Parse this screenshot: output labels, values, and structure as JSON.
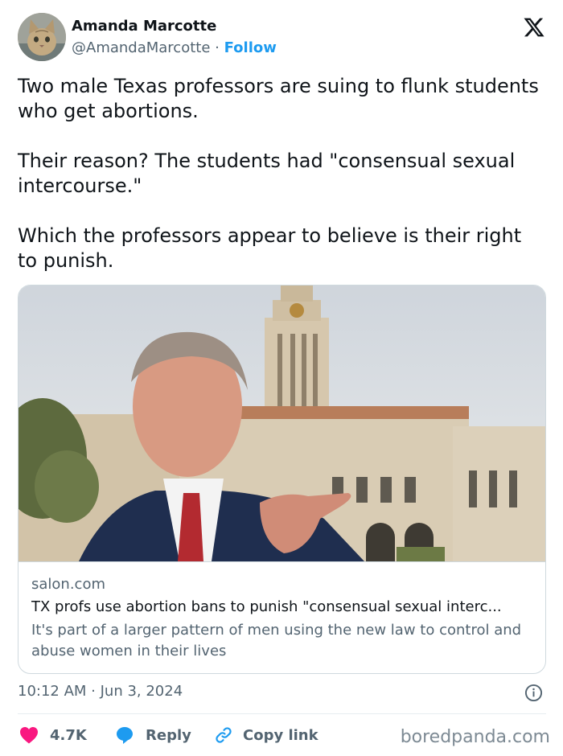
{
  "author": {
    "name": "Amanda Marcotte",
    "handle": "@AmandaMarcotte",
    "separator": "·",
    "follow_label": "Follow"
  },
  "tweet": {
    "paragraphs": [
      "Two male Texas professors are suing to flunk students who get abortions.",
      "Their reason? The students had \"consensual sexual intercourse.\"",
      "Which the professors appear to believe is their right to punish."
    ],
    "timestamp": "10:12 AM · Jun 3, 2024"
  },
  "card": {
    "domain": "salon.com",
    "title": "TX profs use abortion bans to punish \"consensual sexual interc...",
    "description": "It's part of a larger pattern of men using the new law to control and abuse women in their lives"
  },
  "actions": {
    "like_count": "4.7K",
    "reply_label": "Reply",
    "copy_label": "Copy link"
  },
  "watermark": "boredpanda.com",
  "icons": {
    "brand": "x-logo-icon",
    "like": "heart-icon",
    "reply": "speech-bubble-icon",
    "copy": "link-icon",
    "info": "info-icon"
  },
  "colors": {
    "follow": "#1d9bf0",
    "like": "#f91880",
    "reply": "#1d9bf0",
    "copy": "#1d9bf0",
    "muted": "#536471"
  }
}
